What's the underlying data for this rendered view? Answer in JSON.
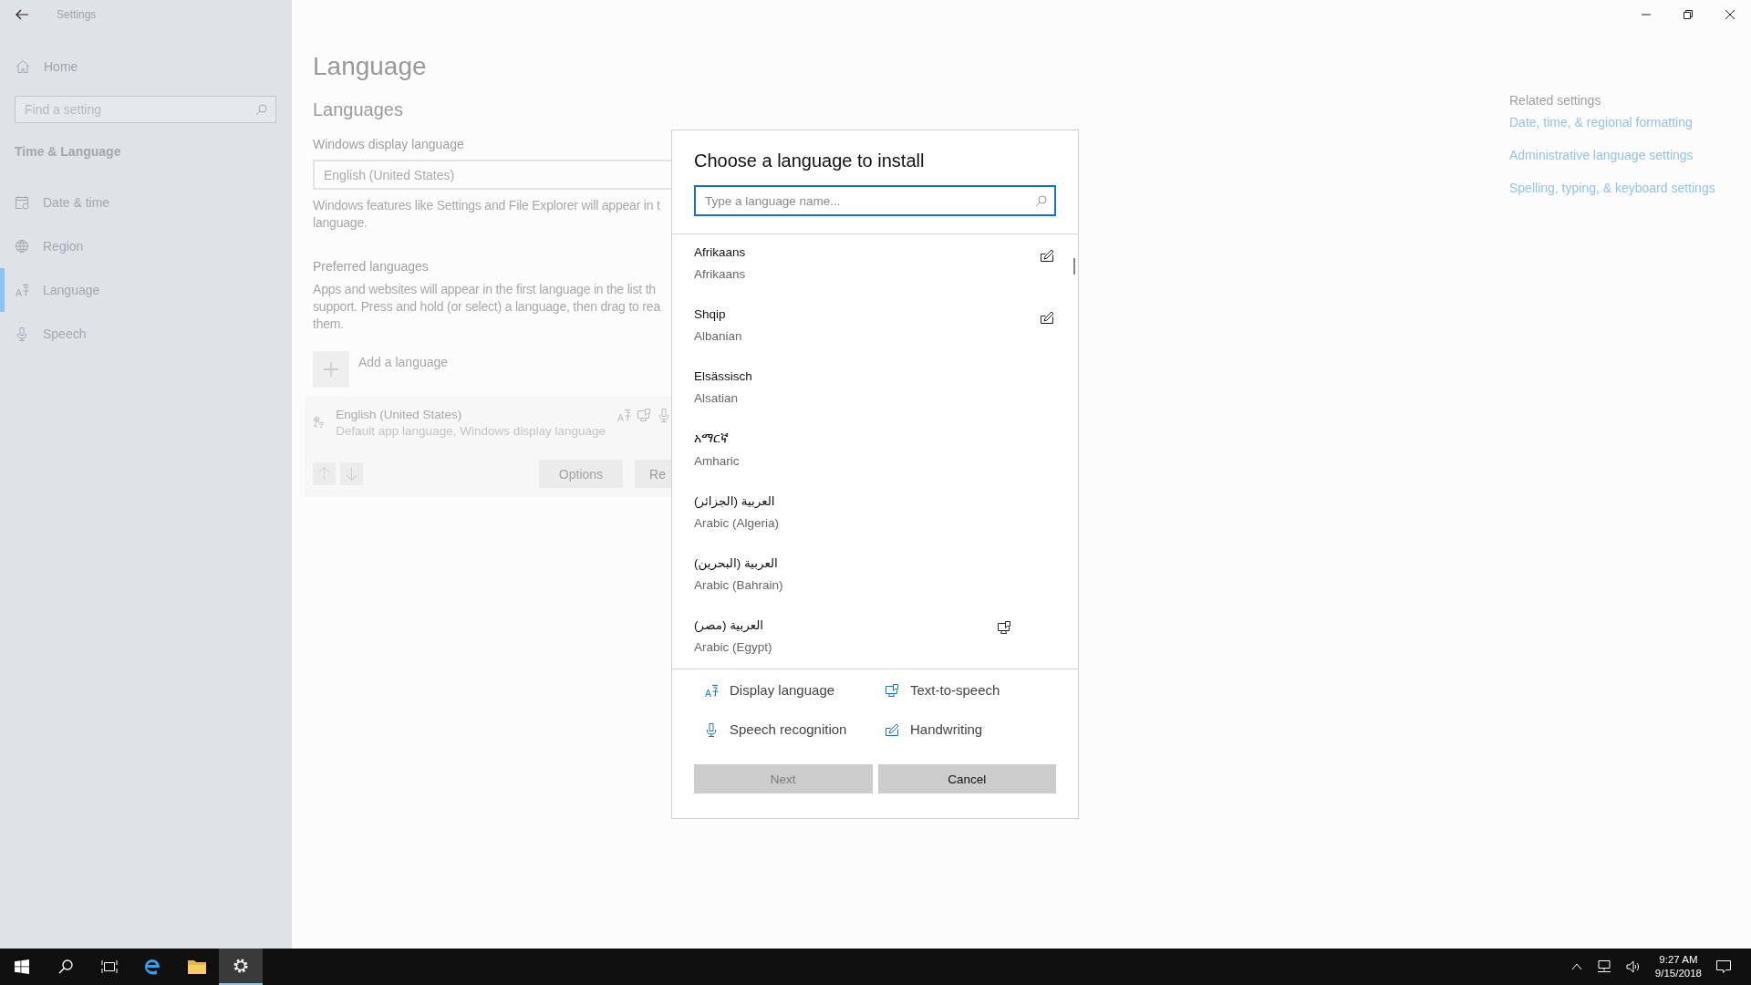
{
  "window": {
    "title": "Settings"
  },
  "sidebar": {
    "home": "Home",
    "search_placeholder": "Find a setting",
    "section": "Time & Language",
    "items": [
      {
        "kind": "calendar",
        "label": "Date & time",
        "selected": false
      },
      {
        "kind": "globe",
        "label": "Region",
        "selected": false
      },
      {
        "kind": "language",
        "label": "Language",
        "selected": true
      },
      {
        "kind": "microphone",
        "label": "Speech",
        "selected": false
      }
    ]
  },
  "page": {
    "title": "Language",
    "heading": "Languages",
    "display_language": {
      "label": "Windows display language",
      "value": "English (United States)",
      "description_lines": [
        "Windows features like Settings and File Explorer will appear in t",
        "language."
      ]
    },
    "preferred": {
      "label": "Preferred languages",
      "description_lines": [
        "Apps and websites will appear in the first language in the list th",
        "support. Press and hold (or select) a language, then drag to rea",
        "them."
      ],
      "add_label": "Add a language",
      "languages": [
        {
          "name": "English (United States)",
          "detail": "Default app language, Windows display language",
          "features": {
            "display": true,
            "tts": true,
            "speech": true
          }
        }
      ],
      "buttons": [
        "Options",
        "Re"
      ]
    }
  },
  "related": {
    "title": "Related settings",
    "links": [
      "Date, time, & regional formatting",
      "Administrative language settings",
      "Spelling, typing, & keyboard settings"
    ]
  },
  "dialog": {
    "title": "Choose a language to install",
    "search_placeholder": "Type a language name...",
    "languages": [
      {
        "native": "Afrikaans",
        "english": "Afrikaans",
        "features": {
          "handwriting": true
        }
      },
      {
        "native": "Shqip",
        "english": "Albanian",
        "features": {
          "handwriting": true
        }
      },
      {
        "native": "Elsässisch",
        "english": "Alsatian"
      },
      {
        "native": "አማርኛ",
        "english": "Amharic"
      },
      {
        "native": "العربية (الجزائر)",
        "english": "Arabic (Algeria)"
      },
      {
        "native": "العربية (البحرين)",
        "english": "Arabic (Bahrain)"
      },
      {
        "native": "العربية (مصر)",
        "english": "Arabic (Egypt)",
        "features": {
          "tts": true
        }
      }
    ],
    "legend": [
      {
        "kind": "display",
        "label": "Display language"
      },
      {
        "kind": "tts",
        "label": "Text-to-speech"
      },
      {
        "kind": "speech",
        "label": "Speech recognition"
      },
      {
        "kind": "handwriting",
        "label": "Handwriting"
      }
    ],
    "buttons": [
      {
        "label": "Next",
        "disabled": true
      },
      {
        "label": "Cancel",
        "disabled": false
      }
    ]
  },
  "taskbar": {
    "apps": [
      {
        "kind": "start",
        "selected": false
      },
      {
        "kind": "search",
        "selected": false
      },
      {
        "kind": "taskview",
        "selected": false
      },
      {
        "kind": "edge",
        "selected": false
      },
      {
        "kind": "explorer",
        "selected": false
      },
      {
        "kind": "settings",
        "selected": true
      }
    ],
    "time": "9:27 AM",
    "date": "9/15/2018"
  }
}
